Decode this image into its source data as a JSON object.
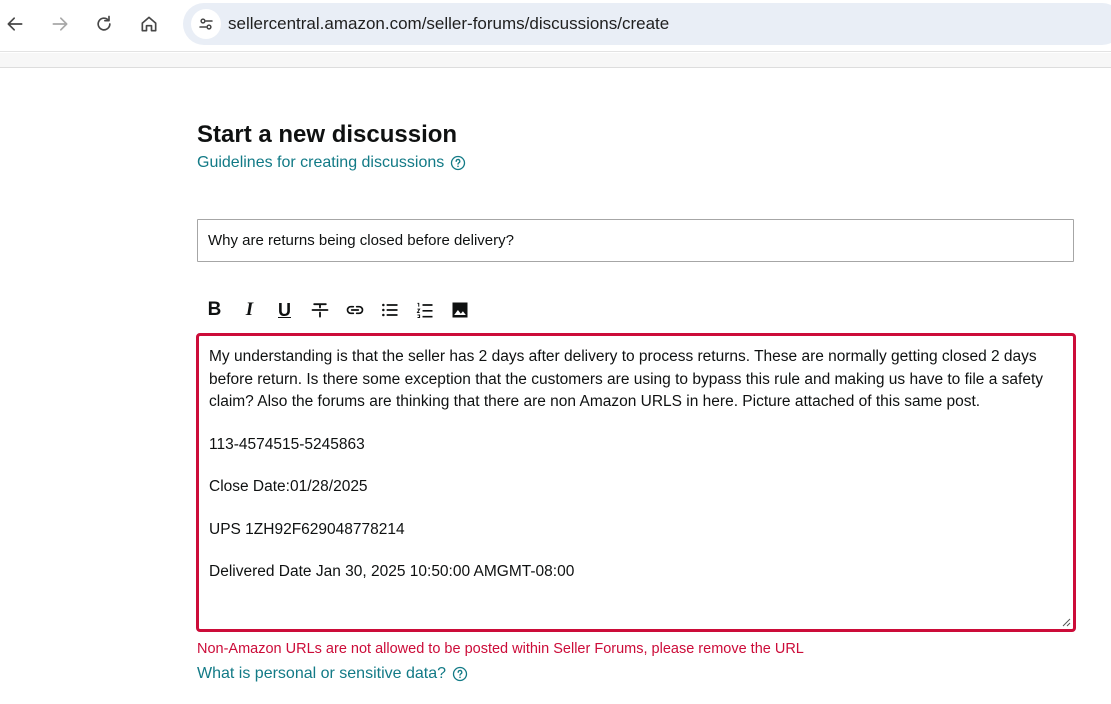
{
  "browser": {
    "url": "sellercentral.amazon.com/seller-forums/discussions/create"
  },
  "form": {
    "heading": "Start a new discussion",
    "guidelines_link": "Guidelines for creating discussions",
    "title_value": "Why are returns being closed before delivery?",
    "toolbar": {
      "bold": "B",
      "italic": "I",
      "underline": "U",
      "icons": [
        "bold-icon",
        "italic-icon",
        "underline-icon",
        "strikethrough-icon",
        "link-icon",
        "bulleted-list-icon",
        "numbered-list-icon",
        "image-icon"
      ]
    },
    "body_paragraphs": [
      "My understanding is that the seller has 2 days after delivery to process returns. These are normally getting closed 2 days before return.  Is there some exception that the customers are using to bypass this rule and making us have to file a safety claim? Also the forums are thinking that there are non Amazon URLS in here. Picture attached of this same post.",
      "113-4574515-5245863",
      "Close Date:01/28/2025",
      "UPS 1ZH92F629048778214",
      "Delivered Date Jan 30, 2025 10:50:00 AMGMT-08:00"
    ],
    "error_message": "Non-Amazon URLs are not allowed to be posted within Seller Forums, please remove the URL",
    "personal_data_link": "What is personal or sensitive data?"
  },
  "colors": {
    "teal_link": "#127a86",
    "error_red": "#cc0c39",
    "text": "#0f1111"
  }
}
